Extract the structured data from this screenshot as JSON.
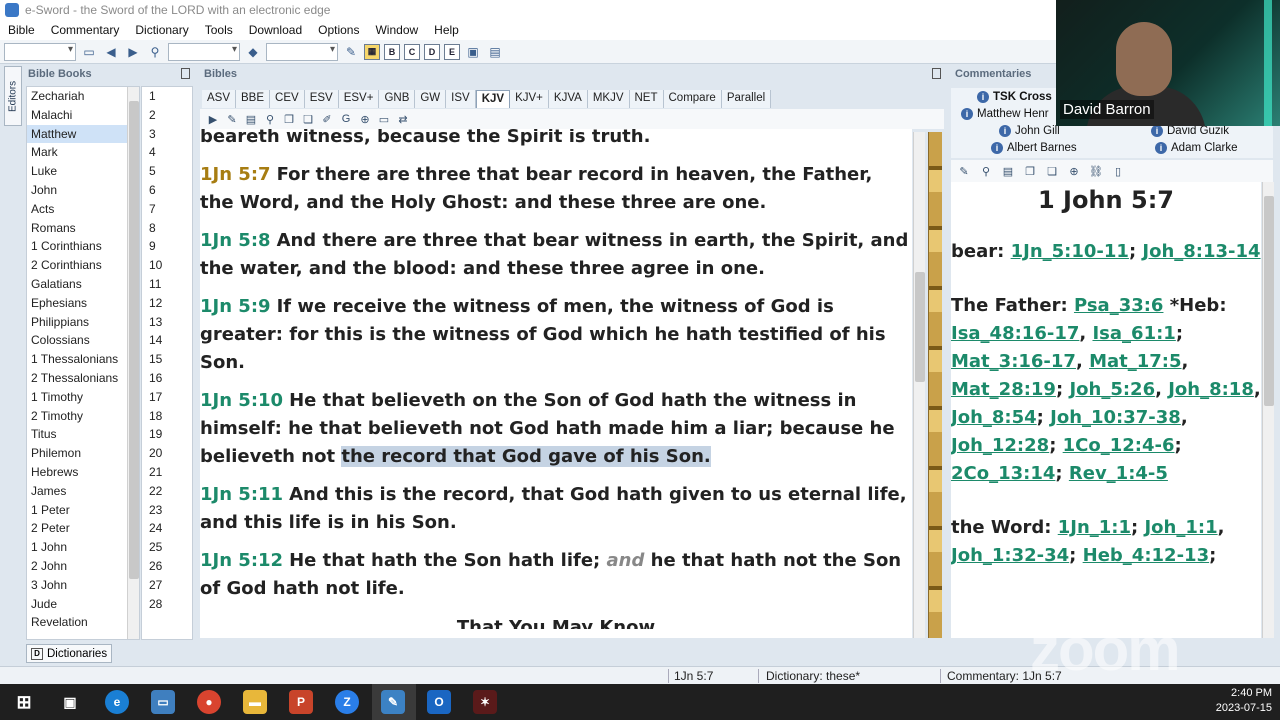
{
  "window": {
    "title": "e-Sword - the Sword of the LORD with an electronic edge"
  },
  "menu": [
    "Bible",
    "Commentary",
    "Dictionary",
    "Tools",
    "Download",
    "Options",
    "Window",
    "Help"
  ],
  "panels": {
    "books_title": "Bible Books",
    "bibles_title": "Bibles",
    "commentaries_title": "Commentaries",
    "editors_tab": "Editors",
    "dictionaries_tab": "Dictionaries"
  },
  "books": [
    "Zechariah",
    "Malachi",
    "Matthew",
    "Mark",
    "Luke",
    "John",
    "Acts",
    "Romans",
    "1 Corinthians",
    "2 Corinthians",
    "Galatians",
    "Ephesians",
    "Philippians",
    "Colossians",
    "1 Thessalonians",
    "2 Thessalonians",
    "1 Timothy",
    "2 Timothy",
    "Titus",
    "Philemon",
    "Hebrews",
    "James",
    "1 Peter",
    "2 Peter",
    "1 John",
    "2 John",
    "3 John",
    "Jude",
    "Revelation"
  ],
  "selected_book": "Matthew",
  "chapters": [
    "1",
    "2",
    "3",
    "4",
    "5",
    "6",
    "7",
    "8",
    "9",
    "10",
    "11",
    "12",
    "13",
    "14",
    "15",
    "16",
    "17",
    "18",
    "19",
    "20",
    "21",
    "22",
    "23",
    "24",
    "25",
    "26",
    "27",
    "28"
  ],
  "bible_tabs": [
    "ASV",
    "BBE",
    "CEV",
    "ESV",
    "ESV+",
    "GNB",
    "GW",
    "ISV",
    "KJV",
    "KJV+",
    "KJVA",
    "MKJV",
    "NET",
    "Compare",
    "Parallel"
  ],
  "active_bible_tab": "KJV",
  "verses": {
    "prev_tail": "beareth witness, because the Spirit is truth.",
    "v7_ref": "1Jn 5:7",
    "v7_text": "For there are three that bear record in heaven, the Father, the Word, and the Holy Ghost: and these three are one.",
    "v8_ref": "1Jn 5:8",
    "v8_text": "And there are three that bear witness in earth, the Spirit, and the water, and the blood: and these three agree in one.",
    "v9_ref": "1Jn 5:9",
    "v9_text": "If we receive the witness of men, the witness of God is greater: for this is the witness of God which he hath testified of his Son.",
    "v10_ref": "1Jn 5:10",
    "v10_text_a": "He that believeth on the Son of God hath the witness in himself: he that believeth not God hath made him a liar; because he believeth not",
    "v10_text_hl": "the record that God gave of his Son.",
    "v11_ref": "1Jn 5:11",
    "v11_text": "And this is the record, that God hath given to us eternal life, and this life is in his Son.",
    "v12_ref": "1Jn 5:12",
    "v12_text_a": "He that hath the Son hath life;",
    "v12_italic": "and",
    "v12_text_b": "he that hath not the Son of God hath not life.",
    "section_heading": "That You May Know"
  },
  "commentary_tabs": {
    "tsk": "TSK Cross",
    "henry": "Matthew Henr",
    "gill": "John Gill",
    "guzik": "David Guzik",
    "barnes": "Albert Barnes",
    "clarke": "Adam Clarke"
  },
  "commentary": {
    "title": "1 John 5:7",
    "bear_label": "bear:",
    "bear_links": [
      "1Jn_5:10-11",
      "Joh_8:13-14"
    ],
    "father_label": "The Father:",
    "father_first": "Psa_33:6",
    "father_heb": "*Heb:",
    "father_links": [
      "Isa_48:16-17",
      "Isa_61:1",
      "Mat_3:16-17",
      "Mat_17:5",
      "Mat_28:19",
      "Joh_5:26",
      "Joh_8:18",
      "Joh_8:54",
      "Joh_10:37-38",
      "Joh_12:28",
      "1Co_12:4-6",
      "2Co_13:14",
      "Rev_1:4-5"
    ],
    "word_label": "the Word:",
    "word_links": [
      "1Jn_1:1",
      "Joh_1:1",
      "Joh_1:32-34",
      "Heb_4:12-13"
    ]
  },
  "status": {
    "ref": "1Jn 5:7",
    "dictionary": "Dictionary: these*",
    "commentary": "Commentary: 1Jn 5:7"
  },
  "taskbar": {
    "time": "2:40 PM",
    "date": "2023-07-15"
  },
  "webcam": {
    "name": "David Barron"
  },
  "watermark": "zoom"
}
